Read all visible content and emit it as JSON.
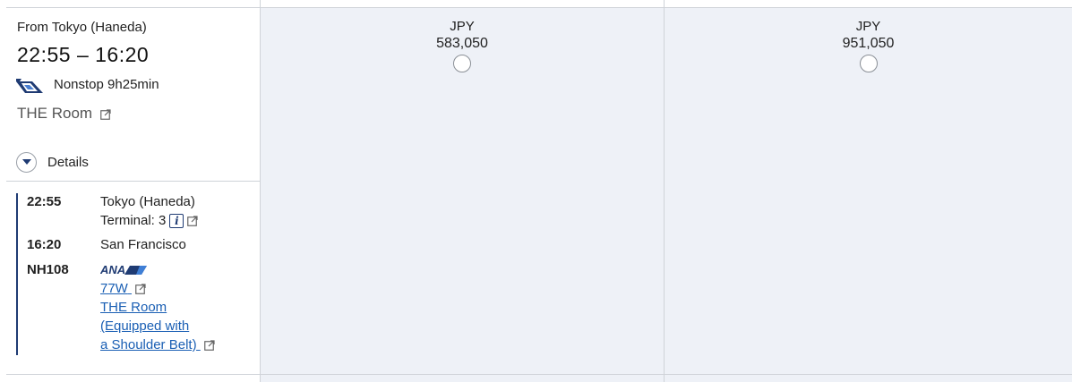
{
  "flight": {
    "from_label": "From Tokyo (Haneda)",
    "times": "22:55 – 16:20",
    "nonstop": "Nonstop 9h25min",
    "seat_product": "THE Room",
    "details_label": "Details"
  },
  "itinerary": {
    "departure": {
      "time": "22:55",
      "place": "Tokyo (Haneda)",
      "terminal": "Terminal: 3"
    },
    "arrival": {
      "time": "16:20",
      "place": "San Francisco"
    },
    "flight_number": "NH108",
    "airline_logo_text": "ANA",
    "aircraft": "77W",
    "seat_link_line1": "THE Room",
    "seat_link_line2": "(Equipped with",
    "seat_link_line3": "a Shoulder Belt)"
  },
  "fares": [
    {
      "currency": "JPY",
      "amount": "583,050"
    },
    {
      "currency": "JPY",
      "amount": "951,050"
    }
  ],
  "colors": {
    "ana_blue": "#1f3b73",
    "link_blue": "#1a5fb4",
    "fare_background": "#eef1f7"
  },
  "icons": [
    "ana-tail-icon",
    "external-link-icon",
    "chevron-down-icon",
    "info-icon",
    "ana-logo"
  ]
}
